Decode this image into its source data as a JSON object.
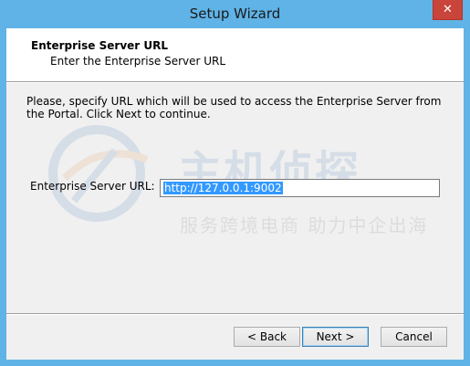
{
  "window": {
    "title": "Setup Wizard",
    "close_glyph": "✕"
  },
  "header": {
    "title": "Enterprise Server URL",
    "subtitle": "Enter the Enterprise Server URL"
  },
  "body": {
    "instructions": "Please, specify URL which will be used to access the Enterprise Server from the Portal. Click Next to continue.",
    "url_label": "Enterprise Server URL:",
    "url_value": "http://127.0.0.1:9002"
  },
  "buttons": {
    "back": "< Back",
    "next": "Next >",
    "cancel": "Cancel"
  },
  "watermark": {
    "main": "主机侦探",
    "sub": "服务跨境电商 助力中企出海"
  },
  "colors": {
    "titlebar": "#5fb3e6",
    "close": "#c9453b",
    "selection": "#3399ff"
  }
}
